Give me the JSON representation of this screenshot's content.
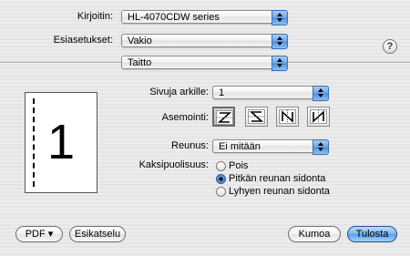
{
  "printer": {
    "label": "Kirjoitin:",
    "value": "HL-4070CDW series"
  },
  "presets": {
    "label": "Esiasetukset:",
    "value": "Vakio"
  },
  "panel": {
    "value": "Taitto"
  },
  "help": {
    "symbol": "?"
  },
  "preview": {
    "page_number": "1"
  },
  "pages_per_sheet": {
    "label": "Sivuja arkille:",
    "value": "1"
  },
  "layout_direction": {
    "label": "Asemointi:",
    "options": [
      {
        "icon": "z-layout-icon",
        "selected": true
      },
      {
        "icon": "reverse-z-layout-icon",
        "selected": false
      },
      {
        "icon": "n-reverse-layout-icon",
        "selected": false
      },
      {
        "icon": "n-layout-icon",
        "selected": false
      }
    ]
  },
  "border": {
    "label": "Reunus:",
    "value": "Ei mitään"
  },
  "two_sided": {
    "label": "Kaksipuolisuus:",
    "options": [
      {
        "label": "Pois",
        "selected": false
      },
      {
        "label": "Pitkän reunan sidonta",
        "selected": true
      },
      {
        "label": "Lyhyen reunan sidonta",
        "selected": false
      }
    ]
  },
  "footer": {
    "pdf": "PDF ▾",
    "preview": "Esikatselu",
    "cancel": "Kumoa",
    "print": "Tulosta"
  }
}
